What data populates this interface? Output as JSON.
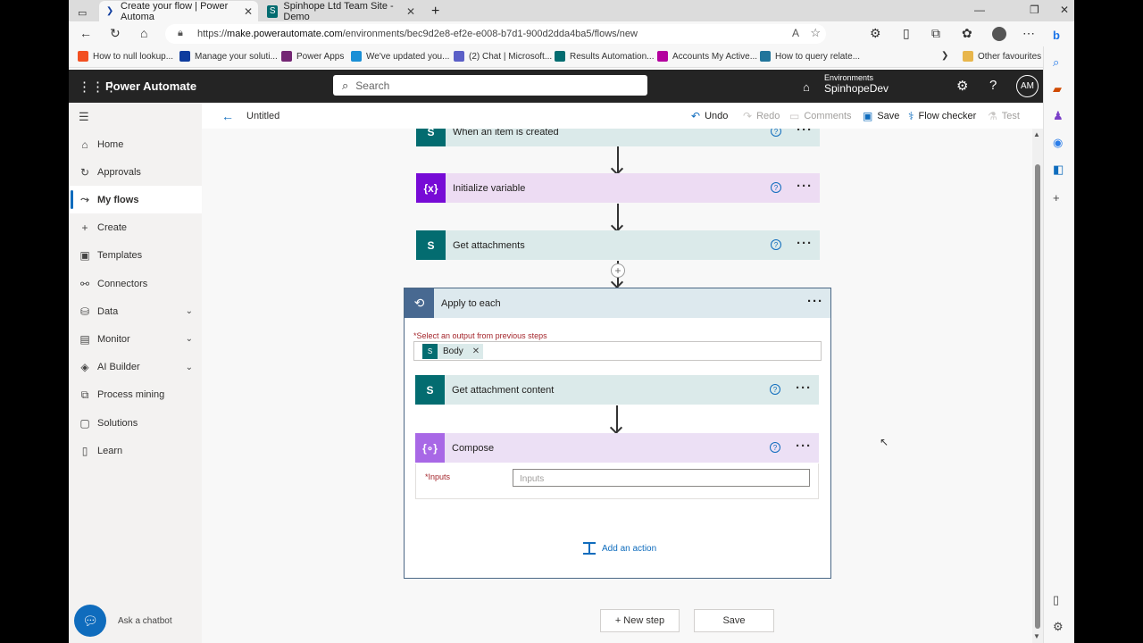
{
  "browser": {
    "tabs": [
      {
        "label": "Create your flow | Power Automa"
      },
      {
        "label": "Spinhope Ltd Team Site - Demo"
      }
    ],
    "url_prefix": "https://",
    "url_host": "make.powerautomate.com",
    "url_path": "/environments/bec9d2e8-ef2e-e008-b7d1-900d2dda4ba5/flows/new",
    "favourites": [
      {
        "label": "How to null lookup...",
        "color": "#f25022"
      },
      {
        "label": "Manage your soluti...",
        "color": "#0f3c9e"
      },
      {
        "label": "Power Apps",
        "color": "#742774"
      },
      {
        "label": "We've updated you...",
        "color": "#1a8fd6"
      },
      {
        "label": "(2) Chat | Microsoft...",
        "color": "#5b5fc7"
      },
      {
        "label": "Results Automation...",
        "color": "#036c70"
      },
      {
        "label": "Accounts My Active...",
        "color": "#b4009e"
      },
      {
        "label": "How to query relate...",
        "color": "#21759b"
      }
    ],
    "other_favourites": "Other favourites"
  },
  "header": {
    "app_title": "Power Automate",
    "search_placeholder": "Search",
    "env_label": "Environments",
    "env_value": "SpinhopeDev",
    "avatar": "AM"
  },
  "nav": {
    "items": [
      {
        "label": "Home",
        "icon": "⌂"
      },
      {
        "label": "Approvals",
        "icon": "↻"
      },
      {
        "label": "My flows",
        "icon": "⤳"
      },
      {
        "label": "Create",
        "icon": "+"
      },
      {
        "label": "Templates",
        "icon": "▣"
      },
      {
        "label": "Connectors",
        "icon": "⚯"
      },
      {
        "label": "Data",
        "icon": "⛁"
      },
      {
        "label": "Monitor",
        "icon": "▤"
      },
      {
        "label": "AI Builder",
        "icon": "◈"
      },
      {
        "label": "Process mining",
        "icon": "⧉"
      },
      {
        "label": "Solutions",
        "icon": "▢"
      },
      {
        "label": "Learn",
        "icon": "▯"
      }
    ],
    "chatbot": "Ask a chatbot"
  },
  "cmdbar": {
    "flow_name": "Untitled",
    "undo": "Undo",
    "redo": "Redo",
    "comments": "Comments",
    "save": "Save",
    "flow_checker": "Flow checker",
    "test": "Test"
  },
  "flow": {
    "trigger": "When an item is created",
    "init_var": "Initialize variable",
    "get_attachments": "Get attachments",
    "apply_to_each": "Apply to each",
    "select_label": "Select an output from previous steps",
    "token": "Body",
    "get_content": "Get attachment content",
    "compose": "Compose",
    "inputs_label": "Inputs",
    "inputs_placeholder": "Inputs",
    "add_action": "Add an action",
    "new_step": "+ New step",
    "save": "Save"
  }
}
